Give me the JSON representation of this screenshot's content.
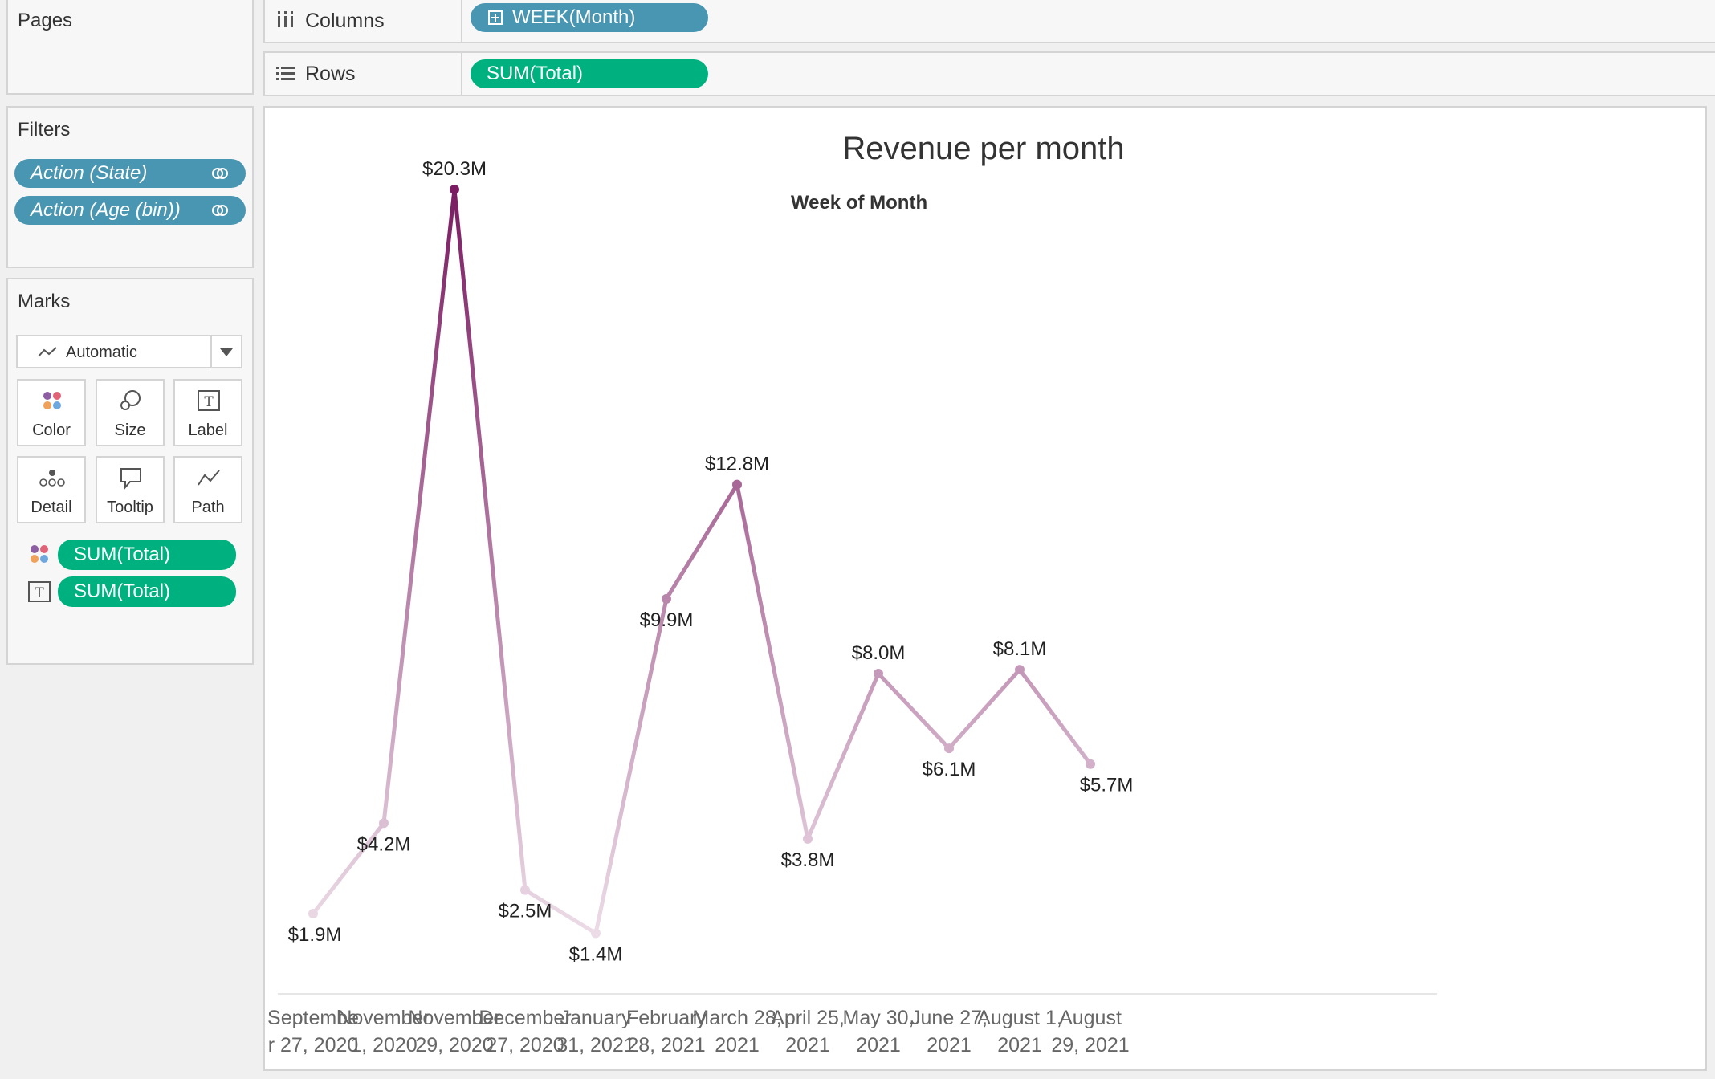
{
  "pages": {
    "title": "Pages"
  },
  "shelves": {
    "columns": {
      "label": "Columns",
      "pill": "WEEK(Month)"
    },
    "rows": {
      "label": "Rows",
      "pill": "SUM(Total)"
    }
  },
  "filters": {
    "title": "Filters",
    "items": [
      {
        "label": "Action (State)"
      },
      {
        "label": "Action (Age (bin))"
      }
    ]
  },
  "marks": {
    "title": "Marks",
    "type": "Automatic",
    "buttons": [
      "Color",
      "Size",
      "Label",
      "Detail",
      "Tooltip",
      "Path"
    ],
    "fields": [
      {
        "kind": "color",
        "label": "SUM(Total)"
      },
      {
        "kind": "label",
        "label": "SUM(Total)"
      }
    ]
  },
  "colors": {
    "pill_blue": "#4996b2",
    "pill_green": "#00b180",
    "line_low": "#ecdce7",
    "line_high": "#7b1c62"
  },
  "chart_data": {
    "type": "line",
    "title": "Revenue per month",
    "header": "Week of Month",
    "categories": [
      [
        "Septembe",
        "r 27, 2020"
      ],
      [
        "November",
        "1, 2020"
      ],
      [
        "November",
        "29, 2020"
      ],
      [
        "December",
        "27, 2020"
      ],
      [
        "January",
        "31, 2021"
      ],
      [
        "February",
        "28, 2021"
      ],
      [
        "March 28,",
        "2021"
      ],
      [
        "April 25,",
        "2021"
      ],
      [
        "May 30,",
        "2021"
      ],
      [
        "June 27,",
        "2021"
      ],
      [
        "August 1,",
        "2021"
      ],
      [
        "August",
        "29, 2021"
      ]
    ],
    "values": [
      1.9,
      4.2,
      20.3,
      2.5,
      1.4,
      9.9,
      12.8,
      3.8,
      8.0,
      6.1,
      8.1,
      5.7
    ],
    "labels": [
      "$1.9M",
      "$4.2M",
      "$20.3M",
      "$2.5M",
      "$1.4M",
      "$9.9M",
      "$12.8M",
      "$3.8M",
      "$8.0M",
      "$6.1M",
      "$8.1M",
      "$5.7M"
    ],
    "unit": "$M",
    "color_encoding": "SUM(Total)",
    "grid": false,
    "legend": "none"
  }
}
